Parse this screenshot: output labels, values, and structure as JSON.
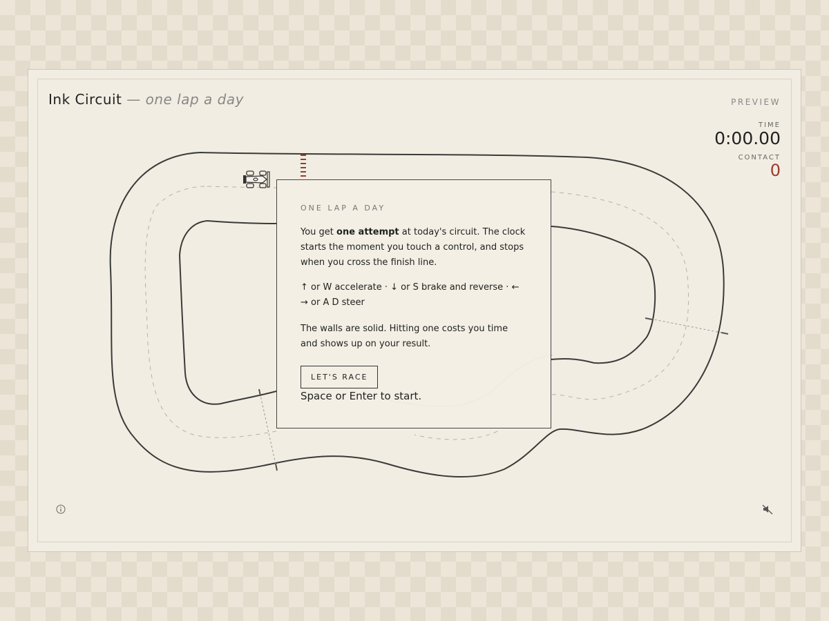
{
  "header": {
    "title": "Ink Circuit",
    "subtitle": "— one lap a day",
    "mode_label": "PREVIEW"
  },
  "hud": {
    "time_label": "TIME",
    "time_value": "0:00.00",
    "contact_label": "CONTACT",
    "contact_value": "0"
  },
  "modal": {
    "heading": "ONE LAP A DAY",
    "intro_pre": "You get ",
    "intro_bold": "one attempt",
    "intro_post": " at today's circuit. The clock starts the moment you touch a control, and stops when you cross the finish line.",
    "controls": "↑ or W accelerate · ↓ or S brake and reverse · ← → or A D steer",
    "walls": "The walls are solid. Hitting one costs you time and shows up on your result.",
    "button_label": "LET'S RACE",
    "start_hint": "Space or Enter to start."
  },
  "icons": {
    "info": "info-icon",
    "sound": "mute-icon",
    "car": "race-car-icon"
  },
  "colors": {
    "accent_red": "#a03a2c",
    "ink": "#333333",
    "paper": "#f1ede2"
  }
}
